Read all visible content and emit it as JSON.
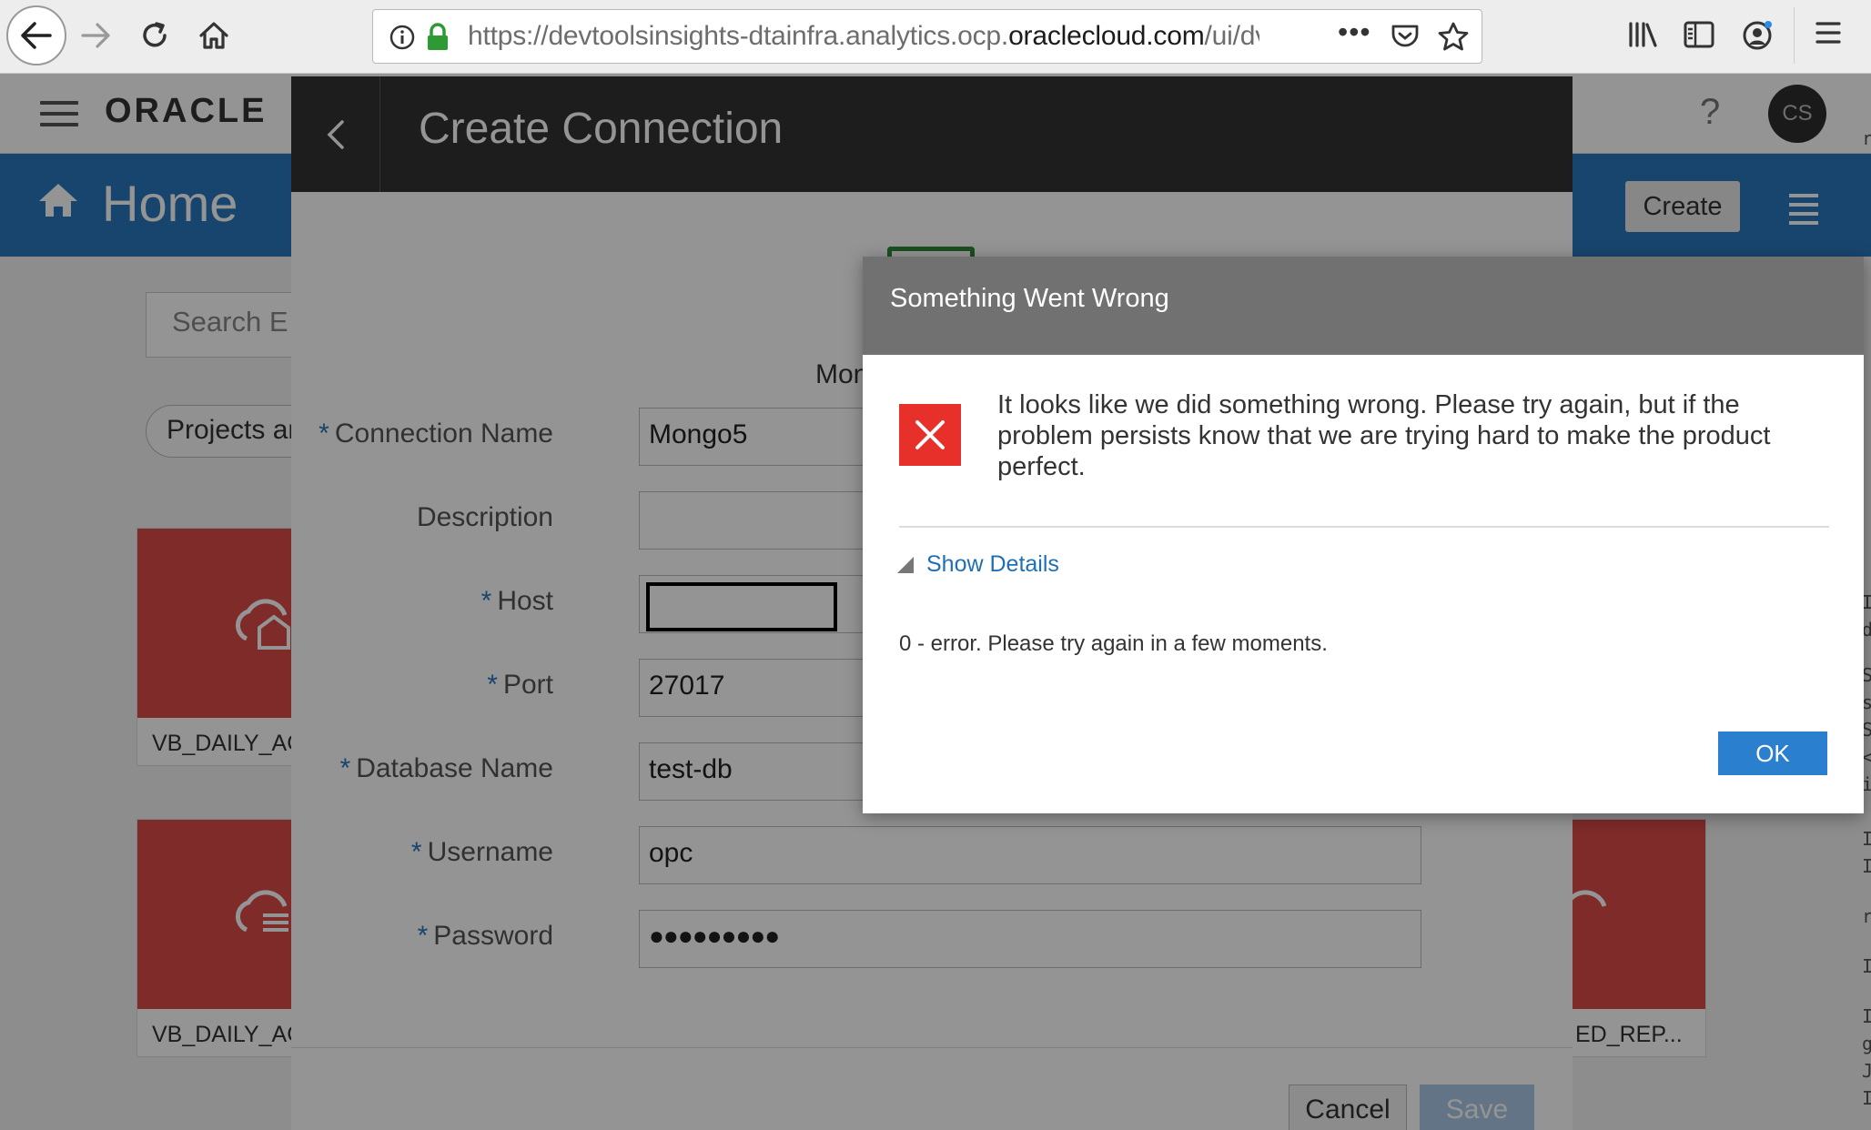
{
  "browser": {
    "url_prefix": "https://devtoolsinsights-dtainfra.analytics.ocp.",
    "url_domain": "oraclecloud.com",
    "url_suffix": "/ui/dv/",
    "url_more": "•••"
  },
  "app": {
    "logo_text": "ORACLE",
    "help": "?",
    "avatar_initials": "CS",
    "home_title": "Home",
    "create_label": "Create",
    "search_placeholder": "Search E",
    "chip_label": "Projects an",
    "tiles": [
      {
        "label": "VB_DAILY_AC"
      },
      {
        "label": "VB_DAILY_AC"
      },
      {
        "label": "ED_REP..."
      }
    ],
    "side_chars": [
      "r",
      "I",
      "d",
      "S",
      "s",
      "S",
      "<",
      "i",
      "I",
      "I",
      "r",
      "I",
      "I",
      "g",
      "J",
      "I"
    ]
  },
  "create_connection": {
    "title": "Create Connection",
    "db_type_label": "Mon",
    "fields": [
      {
        "label": "Connection Name",
        "required": true,
        "value": "Mongo5"
      },
      {
        "label": "Description",
        "required": false,
        "value": ""
      },
      {
        "label": "Host",
        "required": true,
        "value": ""
      },
      {
        "label": "Port",
        "required": true,
        "value": "27017"
      },
      {
        "label": "Database Name",
        "required": true,
        "value": "test-db"
      },
      {
        "label": "Username",
        "required": true,
        "value": "opc"
      },
      {
        "label": "Password",
        "required": true,
        "value": "●●●●●●●●●"
      }
    ],
    "required_mark": "*",
    "cancel_label": "Cancel",
    "save_label": "Save"
  },
  "error_dialog": {
    "title": "Something Went Wrong",
    "message": "It looks like we did something wrong. Please try again, but if the problem persists know that we are trying hard to make the product perfect.",
    "show_details_label": "Show Details",
    "error_text": "0 - error. Please try again in a few moments.",
    "ok_label": "OK"
  },
  "colors": {
    "oracle_blue": "#2a78bd",
    "error_red": "#e8302b",
    "tile_red": "#d94a47",
    "link_blue": "#1f6fb5"
  }
}
